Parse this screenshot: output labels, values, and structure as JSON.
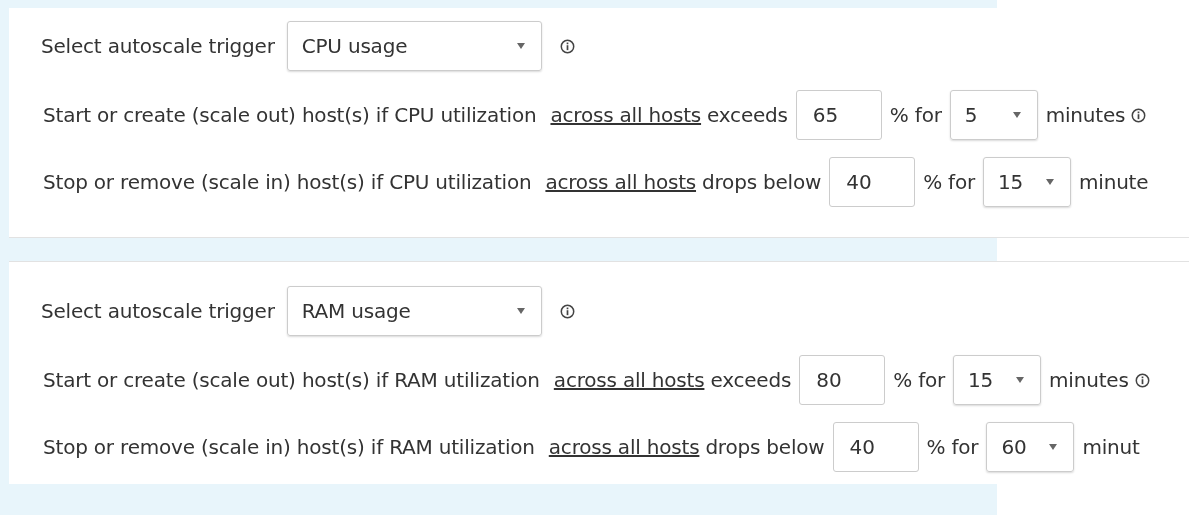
{
  "sections": [
    {
      "trigger_label": "Select autoscale trigger",
      "trigger": {
        "value": "CPU usage"
      },
      "rules": [
        {
          "prefix": "Start or create (scale out) host(s) if CPU utilization",
          "link": "across all hosts",
          "condition": "exceeds",
          "threshold": "65",
          "unit": "% for",
          "duration": "5",
          "suffix": "minutes",
          "info": true
        },
        {
          "prefix": "Stop or remove (scale in) host(s) if CPU utilization",
          "link": "across all hosts",
          "condition": "drops below",
          "threshold": "40",
          "unit": "% for",
          "duration": "15",
          "suffix": "minute"
        }
      ]
    },
    {
      "trigger_label": "Select autoscale trigger",
      "trigger": {
        "value": "RAM usage"
      },
      "rules": [
        {
          "prefix": "Start or create (scale out) host(s) if RAM utilization",
          "link": "across all hosts",
          "condition": "exceeds",
          "threshold": "80",
          "unit": "% for",
          "duration": "15",
          "suffix": "minutes",
          "info": true
        },
        {
          "prefix": "Stop or remove (scale in) host(s) if RAM utilization",
          "link": "across all hosts",
          "condition": "drops below",
          "threshold": "40",
          "unit": "% for",
          "duration": "60",
          "suffix": "minut"
        }
      ]
    }
  ]
}
